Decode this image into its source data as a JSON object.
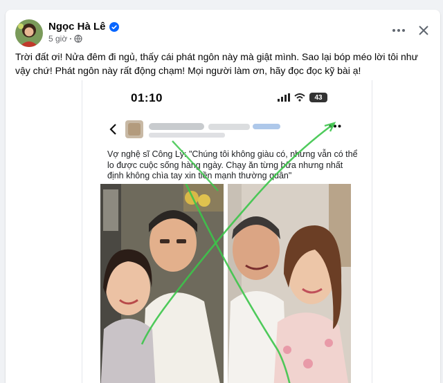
{
  "post": {
    "author": "Ngọc Hà Lê",
    "time": "5 giờ",
    "dot": "·",
    "text": "Trời đất ơi! Nửa đêm đi ngủ, thấy cái phát ngôn này mà giật mình. Sao lại bóp méo lời tôi như vậy chứ! Phát ngôn này rất động chạm! Mọi người làm ơn, hãy đọc đọc kỹ bài ạ!"
  },
  "icons": {
    "verified": "verified-badge-icon",
    "privacy": "globe-icon",
    "more": "more-dots-icon",
    "close": "close-icon",
    "back": "chevron-left-icon",
    "signal": "signal-icon",
    "wifi": "wifi-icon",
    "battery": "battery-icon"
  },
  "screenshot": {
    "status_time": "01:10",
    "battery_level": "43",
    "caption": "Vợ nghệ sĩ Công Lý: \"Chúng tôi không giàu có, nhưng vẫn có thể lo được cuộc sống hàng ngày. Chạy ăn từng bữa nhưng nhất định không chìa tay xin tiền mạnh thường quân\""
  },
  "colors": {
    "accent": "#0866ff",
    "cross": "#3cc54a",
    "text_secondary": "#65676b"
  }
}
